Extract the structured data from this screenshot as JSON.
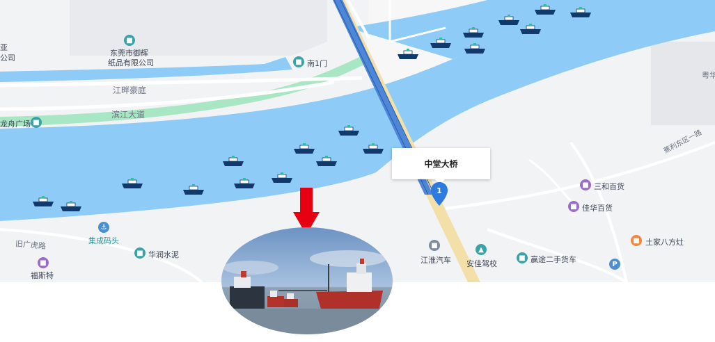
{
  "map": {
    "colors": {
      "land": "#f2f3f5",
      "water": "#8ecbf6",
      "road": "#ffffff",
      "green": "#a9e6c3",
      "bridge_blue": "#4e86d8",
      "arrow": "#e60012"
    },
    "bridge_callout": "中堂大桥",
    "pin_number": "1",
    "labels": {
      "left_edge_top": "亚",
      "left_edge_top2": "公司",
      "company": "东莞市御辉",
      "company2": "纸品有限公司",
      "river_garden": "江畔豪庭",
      "south_gate": "南1门",
      "binjiang_road": "滨江大道",
      "dragon_square": "龙舟广场",
      "jicheng_wharf": "集成码头",
      "old_guangdong_road": "旧广虎路",
      "huarun_cement": "华润水泥",
      "fusite": "福斯特",
      "jianghuai_auto": "江淮汽车",
      "anjia_driving": "安佳驾校",
      "yingtu_truck": "赢途二手货车",
      "sanhe_store": "三和百货",
      "jiahua_store": "佳华百货",
      "tujia_stove": "土家八方灶",
      "jili_road": "蕉利东区一路",
      "right_edge": "粤华"
    },
    "icons": {
      "company": "building-icon",
      "south_gate": "gate-icon",
      "dragon_square": "square-icon",
      "jicheng_wharf": "anchor-icon",
      "huarun_cement": "building-icon",
      "fusite": "shop-icon",
      "jianghuai_auto": "car-icon",
      "anjia_driving": "tree-icon",
      "yingtu_truck": "car-icon",
      "sanhe_store": "shop-icon",
      "jiahua_store": "shop-icon",
      "tujia_stove": "food-icon",
      "parking": "parking-icon"
    },
    "parking_symbol": "P",
    "ship_count": 21
  },
  "photo": {
    "description_icon": "ship-photo"
  }
}
